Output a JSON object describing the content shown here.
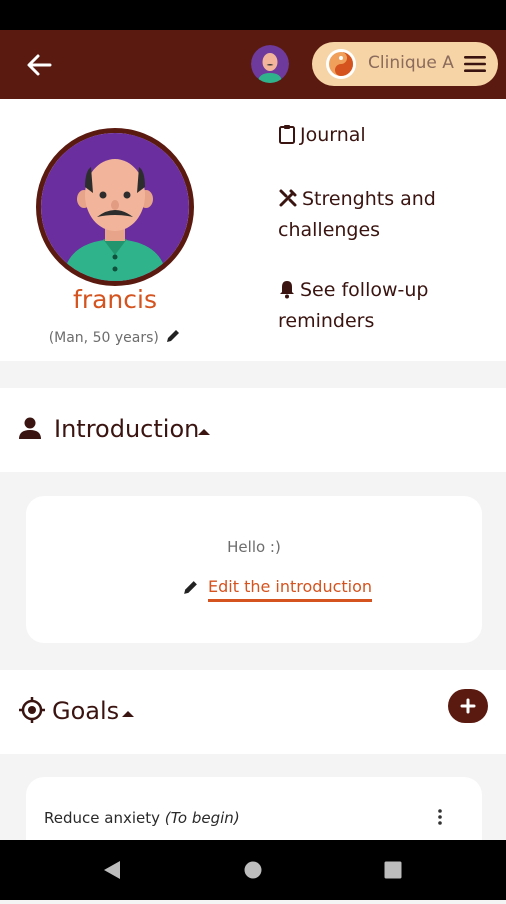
{
  "header": {
    "clinic_name": "Clinique A"
  },
  "profile": {
    "name": "francis",
    "meta": "(Man, 50 years)"
  },
  "links": [
    {
      "label": "Journal",
      "icon": "clipboard-icon"
    },
    {
      "label": "Strenghts and challenges",
      "icon": "tools-icon"
    },
    {
      "label": "See follow-up reminders",
      "icon": "bell-icon"
    }
  ],
  "introduction": {
    "title": "Introduction",
    "text": "Hello :)",
    "edit_label": "Edit the introduction"
  },
  "goals": {
    "title": "Goals",
    "items": [
      {
        "name": "Reduce anxiety",
        "status": "(To begin)"
      }
    ]
  },
  "colors": {
    "brand": "#5b1a10",
    "accent": "#d4531e",
    "pill": "#f6d4a6"
  }
}
